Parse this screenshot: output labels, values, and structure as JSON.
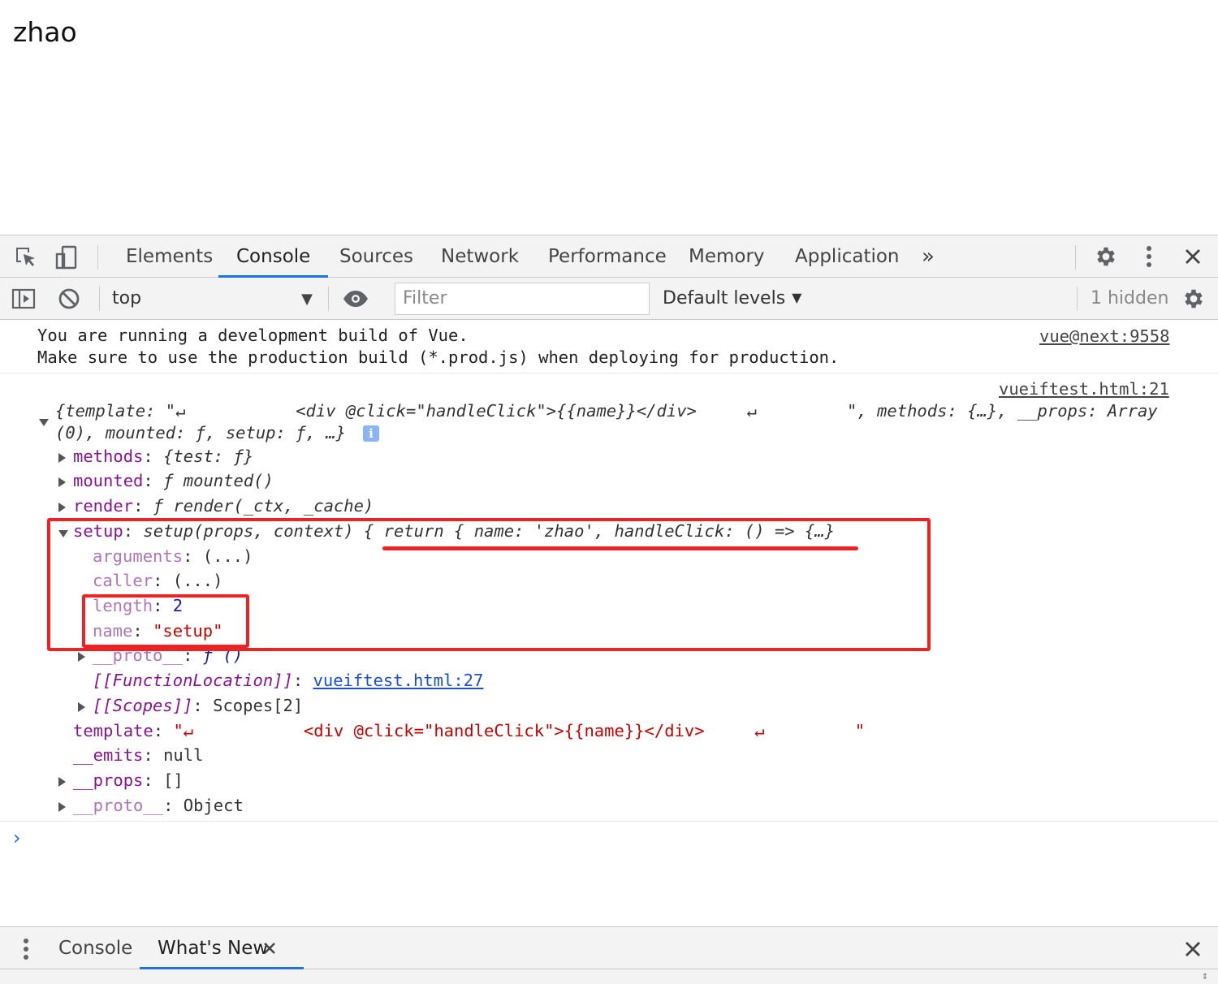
{
  "page": {
    "text": "zhao"
  },
  "devtools": {
    "tabs": [
      "Elements",
      "Console",
      "Sources",
      "Network",
      "Performance",
      "Memory",
      "Application"
    ],
    "active_tab": "Console",
    "more_tabs_icon": "chevron-double-right-icon",
    "toolbar_icons": [
      "inspect-element-icon",
      "device-toggle-icon",
      "gear-icon",
      "kebab-menu-icon",
      "close-icon"
    ],
    "console_toolbar": {
      "context": "top",
      "filter_placeholder": "Filter",
      "levels": "Default levels",
      "hidden": "1 hidden"
    }
  },
  "console": {
    "message1": {
      "line1": "You are running a development build of Vue.",
      "line2": "Make sure to use the production build (*.prod.js) when deploying for production.",
      "source": "vue@next:9558"
    },
    "message2": {
      "source": "vueiftest.html:21",
      "summary1": "{template: \"↵           <div @click=\"handleClick\">{{name}}</div>     ↵         \", methods: {…}, __props: Array",
      "summary2": "(0), mounted: ƒ, setup: ƒ, …}",
      "info_badge": "i",
      "props": [
        {
          "key": "methods",
          "sep": ": ",
          "value": "{test: ƒ}"
        },
        {
          "key": "mounted",
          "sep": ": ",
          "value": "ƒ mounted()"
        },
        {
          "key": "render",
          "sep": ": ",
          "value": "ƒ render(_ctx, _cache)"
        },
        {
          "key": "setup",
          "sep": ": ",
          "value": "setup(props, context) { return { name: 'zhao', handleClick: () => {…}"
        }
      ],
      "setup_children": [
        {
          "key": "arguments",
          "value": "(...)"
        },
        {
          "key": "caller",
          "value": "(...)"
        },
        {
          "key": "length",
          "value": "2"
        },
        {
          "key": "name",
          "value": "\"setup\""
        },
        {
          "key": "__proto__",
          "value": "ƒ ()"
        },
        {
          "key": "[[FunctionLocation]]",
          "value": "vueiftest.html:27"
        },
        {
          "key": "[[Scopes]]",
          "value": "Scopes[2]"
        }
      ],
      "tail_props": [
        {
          "key": "template",
          "value": "\"↵           <div @click=\"handleClick\">{{name}}</div>     ↵         \""
        },
        {
          "key": "__emits",
          "value": "null"
        },
        {
          "key": "__props",
          "value": "[]"
        },
        {
          "key": "__proto__",
          "value": "Object"
        }
      ]
    },
    "prompt": "›"
  },
  "drawer": {
    "tabs": [
      "Console",
      "What's New"
    ],
    "active_tab": "What's New",
    "close_tab_icon": "close-icon",
    "close_drawer_icon": "close-icon"
  },
  "annotation_color": "#ee2222"
}
